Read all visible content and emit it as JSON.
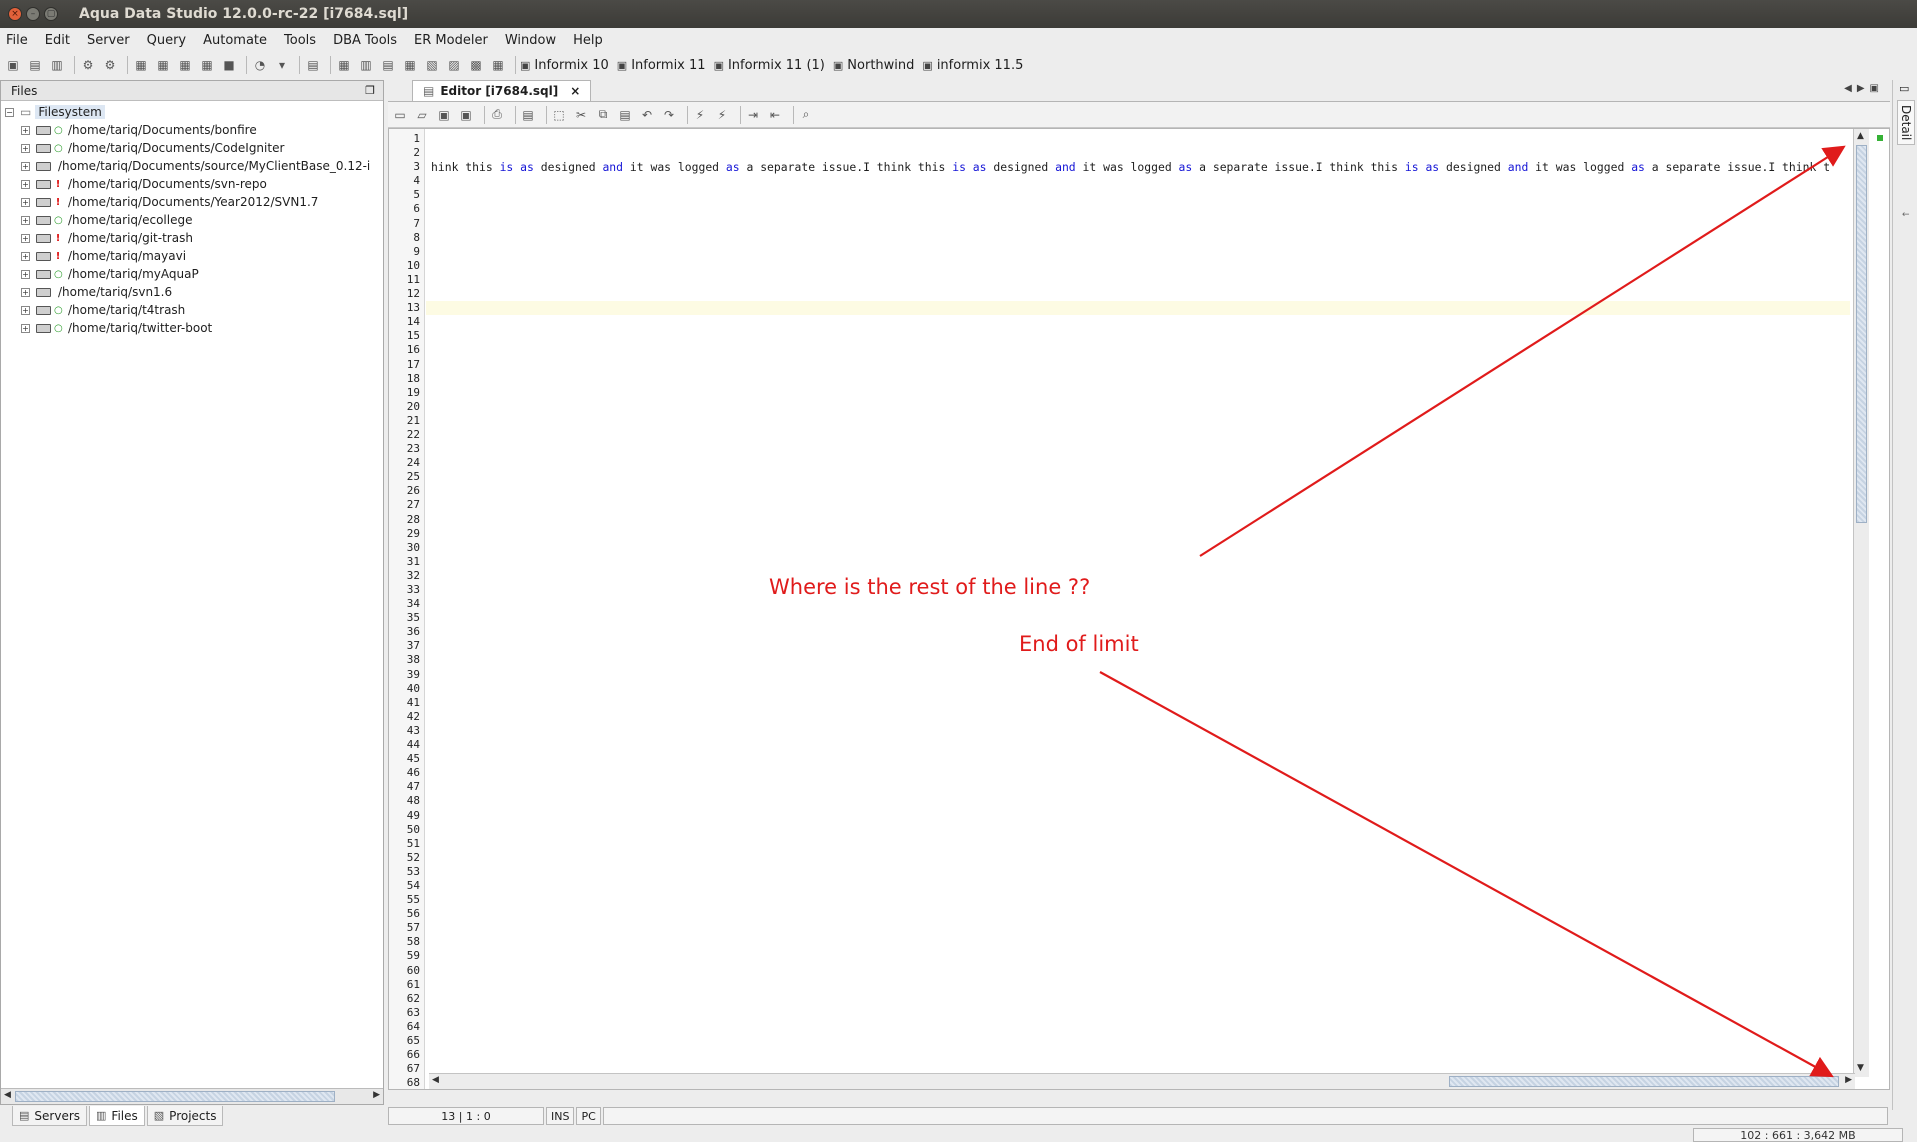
{
  "window": {
    "title": "Aqua Data Studio 12.0.0-rc-22 [i7684.sql]",
    "buttons": [
      "×",
      "–",
      "▢"
    ]
  },
  "menu": [
    "File",
    "Edit",
    "Server",
    "Query",
    "Automate",
    "Tools",
    "DBA Tools",
    "ER Modeler",
    "Window",
    "Help"
  ],
  "toolbar": {
    "servers": [
      {
        "label": "Informix 10",
        "icon": "server-icon"
      },
      {
        "label": "Informix 11",
        "icon": "server-icon"
      },
      {
        "label": "Informix 11 (1)",
        "icon": "server-icon"
      },
      {
        "label": "Northwind",
        "icon": "server-icon"
      },
      {
        "label": "informix 11.5",
        "icon": "server-icon"
      }
    ]
  },
  "files_panel": {
    "title": "Files",
    "root": "Filesystem",
    "items": [
      {
        "path": "/home/tariq/Documents/bonfire",
        "status": "ok"
      },
      {
        "path": "/home/tariq/Documents/CodeIgniter",
        "status": "ok"
      },
      {
        "path": "/home/tariq/Documents/source/MyClientBase_0.12-i",
        "status": "none"
      },
      {
        "path": "/home/tariq/Documents/svn-repo",
        "status": "err"
      },
      {
        "path": "/home/tariq/Documents/Year2012/SVN1.7",
        "status": "err"
      },
      {
        "path": "/home/tariq/ecollege",
        "status": "ok"
      },
      {
        "path": "/home/tariq/git-trash",
        "status": "err"
      },
      {
        "path": "/home/tariq/mayavi",
        "status": "err"
      },
      {
        "path": "/home/tariq/myAquaP",
        "status": "ok"
      },
      {
        "path": "/home/tariq/svn1.6",
        "status": "none"
      },
      {
        "path": "/home/tariq/t4trash",
        "status": "ok"
      },
      {
        "path": "/home/tariq/twitter-boot",
        "status": "ok"
      }
    ]
  },
  "bottom_tabs": [
    "Servers",
    "Files",
    "Projects"
  ],
  "editor": {
    "tab_label": "Editor [i7684.sql]",
    "line1_segments": [
      {
        "t": "hink this ",
        "kw": false
      },
      {
        "t": "is",
        "kw": true
      },
      {
        "t": " ",
        "kw": false
      },
      {
        "t": "as",
        "kw": true
      },
      {
        "t": " designed ",
        "kw": false
      },
      {
        "t": "and",
        "kw": true
      },
      {
        "t": " it was logged ",
        "kw": false
      },
      {
        "t": "as",
        "kw": true
      },
      {
        "t": " a separate issue.I think this ",
        "kw": false
      },
      {
        "t": "is",
        "kw": true
      },
      {
        "t": " ",
        "kw": false
      },
      {
        "t": "as",
        "kw": true
      },
      {
        "t": " designed ",
        "kw": false
      },
      {
        "t": "and",
        "kw": true
      },
      {
        "t": " it was logged ",
        "kw": false
      },
      {
        "t": "as",
        "kw": true
      },
      {
        "t": " a separate issue.I think this ",
        "kw": false
      },
      {
        "t": "is",
        "kw": true
      },
      {
        "t": " ",
        "kw": false
      },
      {
        "t": "as",
        "kw": true
      },
      {
        "t": " designed ",
        "kw": false
      },
      {
        "t": "and",
        "kw": true
      },
      {
        "t": " it was logged ",
        "kw": false
      },
      {
        "t": "as",
        "kw": true
      },
      {
        "t": " a separate issue.I think t",
        "kw": false
      }
    ],
    "line_count": 68,
    "current_line": 13
  },
  "status_bar": {
    "position": "13 | 1 : 0",
    "mode": "INS",
    "line_ending": "PC"
  },
  "memory": "102 : 661 : 3,642 MB",
  "detail_tab": "Detail",
  "annotations": {
    "question": "Where is the rest of the line ??",
    "limit": "End of limit",
    "color": "#e01b1b"
  }
}
